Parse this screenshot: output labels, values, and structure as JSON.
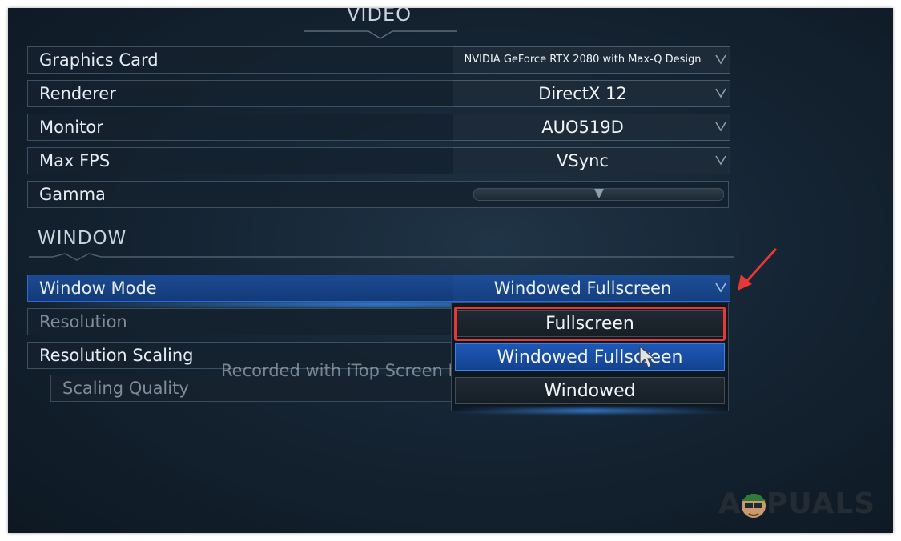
{
  "video_section": {
    "title": "VIDEO"
  },
  "settings": {
    "graphics_card": {
      "label": "Graphics Card",
      "value": "NVIDIA GeForce RTX 2080 with Max-Q Design"
    },
    "renderer": {
      "label": "Renderer",
      "value": "DirectX 12"
    },
    "monitor": {
      "label": "Monitor",
      "value": "AUO519D"
    },
    "max_fps": {
      "label": "Max FPS",
      "value": "VSync"
    },
    "gamma": {
      "label": "Gamma"
    }
  },
  "window_section": {
    "title": "WINDOW"
  },
  "window": {
    "window_mode": {
      "label": "Window Mode",
      "value": "Windowed Fullscreen"
    },
    "resolution": {
      "label": "Resolution"
    },
    "resolution_scaling": {
      "label": "Resolution Scaling"
    },
    "scaling_quality": {
      "label": "Scaling Quality"
    }
  },
  "dropdown_options": [
    "Fullscreen",
    "Windowed Fullscreen",
    "Windowed"
  ],
  "selected_option": "Windowed Fullscreen",
  "watermark": "Recorded with iTop Screen Recorder",
  "logo": {
    "a": "A",
    "text": "PUALS"
  },
  "colors": {
    "highlight": "#1e58b8",
    "annotation_red": "#e53935",
    "background": "#152433"
  }
}
